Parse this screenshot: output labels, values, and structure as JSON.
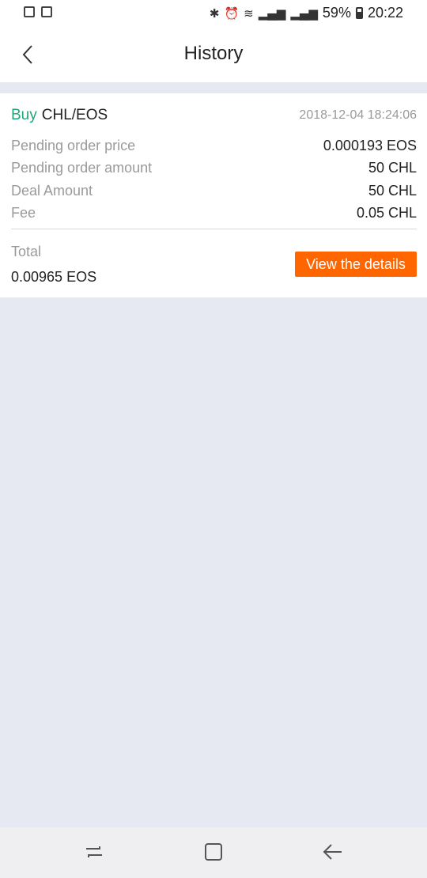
{
  "status_bar": {
    "battery_percent": "59%",
    "time": "20:22",
    "left_icons": [
      "gallery-icon",
      "checkbox-icon"
    ],
    "right_icons": [
      "bluetooth-icon",
      "alarm-icon",
      "wifi-icon",
      "signal-icon",
      "signal-3g-icon",
      "battery-icon"
    ]
  },
  "header": {
    "title": "History"
  },
  "order": {
    "side": "Buy",
    "pair": "CHL/EOS",
    "timestamp": "2018-12-04 18:24:06",
    "rows": [
      {
        "label": "Pending order price",
        "value": "0.000193 EOS"
      },
      {
        "label": "Pending order amount",
        "value": "50 CHL"
      },
      {
        "label": "Deal Amount",
        "value": "50 CHL"
      },
      {
        "label": "Fee",
        "value": "0.05 CHL"
      }
    ],
    "total_label": "Total",
    "total_value": "0.00965 EOS",
    "details_button_label": "View the details"
  },
  "colors": {
    "buy": "#1fa67a",
    "accent": "#ff6600",
    "background": "#e6e8f2"
  }
}
